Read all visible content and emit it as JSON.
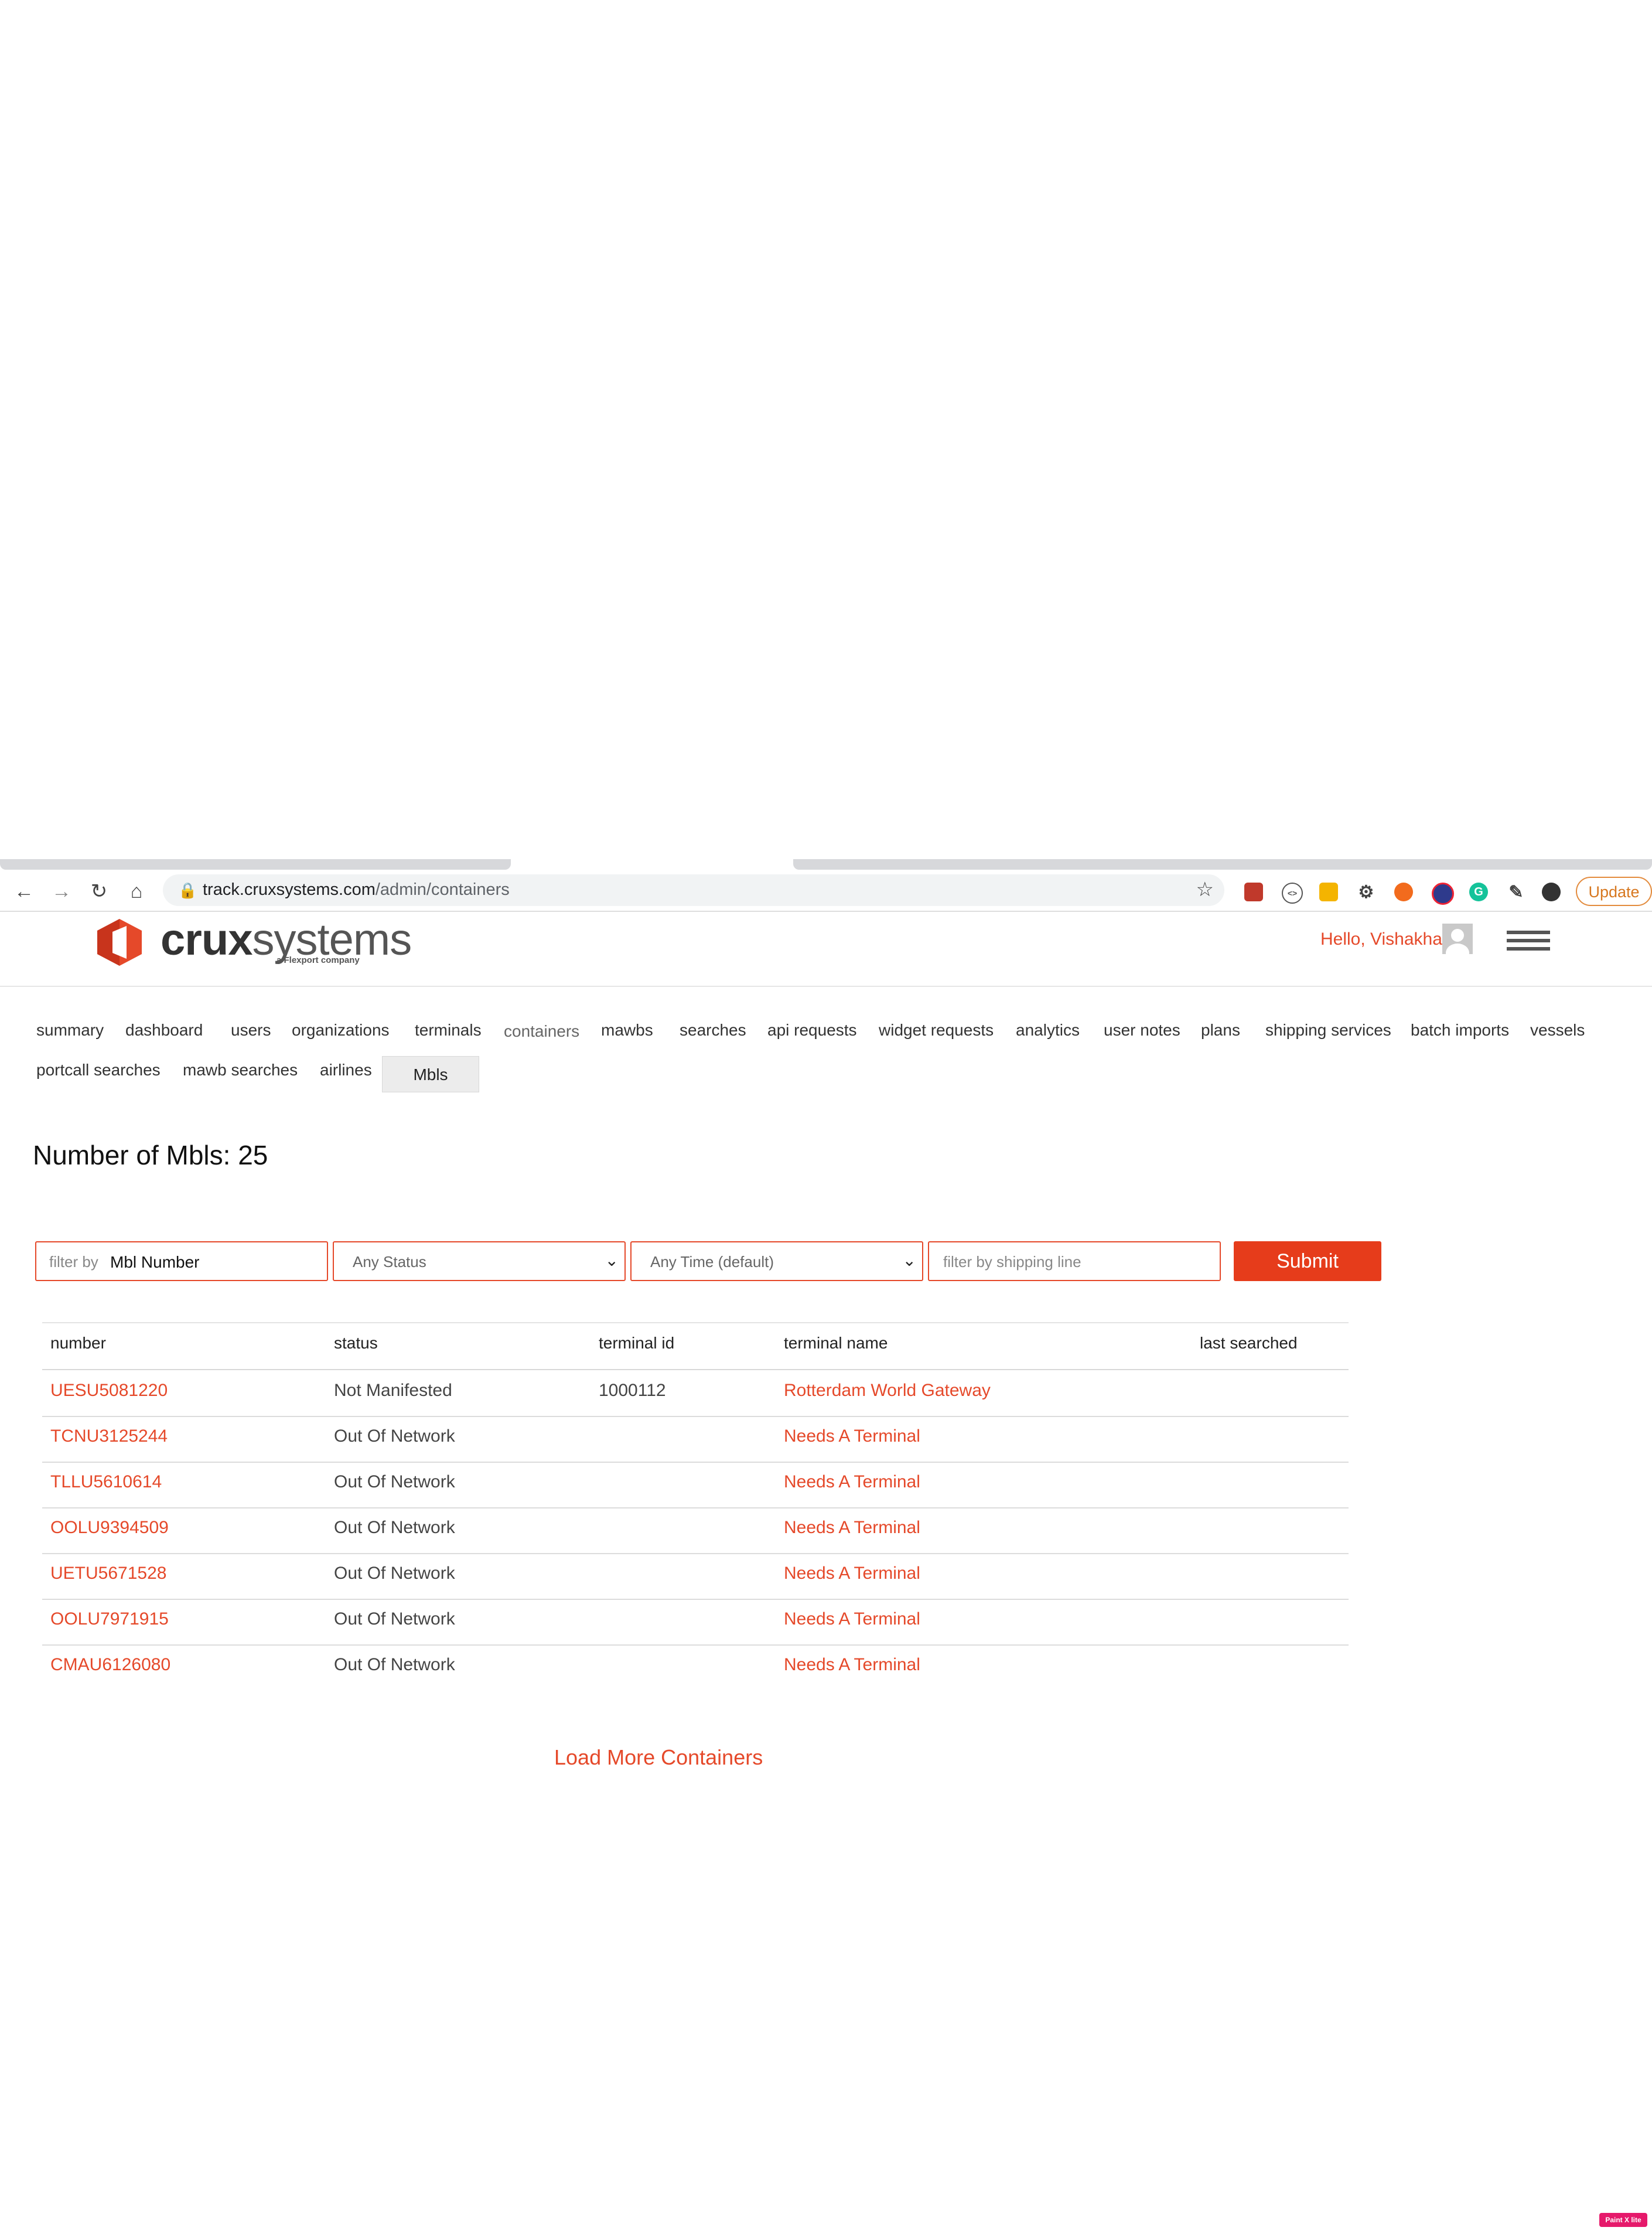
{
  "browser": {
    "url_host": "track.cruxsystems.com",
    "url_path": "/admin/containers",
    "update_label": "Update",
    "extension_icons": [
      "bookmark-ext-icon",
      "code-ext-icon",
      "notes-ext-icon",
      "gear-ext-icon",
      "flame-ext-icon",
      "color-ext-icon",
      "grammarly-ext-icon",
      "puzzle-ext-icon",
      "profile-ext-icon"
    ]
  },
  "header": {
    "logo_crux": "crux",
    "logo_systems": "systems",
    "logo_sub": "a Flexport company",
    "greeting": "Hello, Vishakha"
  },
  "nav": {
    "items": [
      "summary",
      "dashboard",
      "users",
      "organizations",
      "terminals",
      "containers",
      "mawbs",
      "searches",
      "api requests",
      "widget requests",
      "analytics",
      "user notes",
      "plans",
      "shipping services",
      "batch imports",
      "vessels",
      "portcall searches",
      "mawb searches",
      "airlines"
    ],
    "active": "Mbls"
  },
  "main": {
    "count_title": "Number of Mbls: 25"
  },
  "filters": {
    "filter_by_label": "filter by",
    "filter_by_value": "Mbl Number",
    "status_selected": "Any Status",
    "time_selected": "Any Time (default)",
    "shipping_line_placeholder": "filter by shipping line",
    "submit_label": "Submit"
  },
  "table": {
    "columns": [
      "number",
      "status",
      "terminal id",
      "terminal name",
      "last searched"
    ],
    "rows": [
      {
        "number": "UESU5081220",
        "status": "Not Manifested",
        "terminal_id": "1000112",
        "terminal_name": "Rotterdam World Gateway",
        "last_searched": ""
      },
      {
        "number": "TCNU3125244",
        "status": "Out Of Network",
        "terminal_id": "",
        "terminal_name": "Needs A Terminal",
        "last_searched": ""
      },
      {
        "number": "TLLU5610614",
        "status": "Out Of Network",
        "terminal_id": "",
        "terminal_name": "Needs A Terminal",
        "last_searched": ""
      },
      {
        "number": "OOLU9394509",
        "status": "Out Of Network",
        "terminal_id": "",
        "terminal_name": "Needs A Terminal",
        "last_searched": ""
      },
      {
        "number": "UETU5671528",
        "status": "Out Of Network",
        "terminal_id": "",
        "terminal_name": "Needs A Terminal",
        "last_searched": ""
      },
      {
        "number": "OOLU7971915",
        "status": "Out Of Network",
        "terminal_id": "",
        "terminal_name": "Needs A Terminal",
        "last_searched": ""
      },
      {
        "number": "CMAU6126080",
        "status": "Out Of Network",
        "terminal_id": "",
        "terminal_name": "Needs A Terminal",
        "last_searched": ""
      }
    ]
  },
  "footer": {
    "load_more_label": "Load More Containers",
    "badge_label": "Paint X lite"
  },
  "colors": {
    "accent": "#e5492a",
    "submit": "#e63c1b"
  }
}
